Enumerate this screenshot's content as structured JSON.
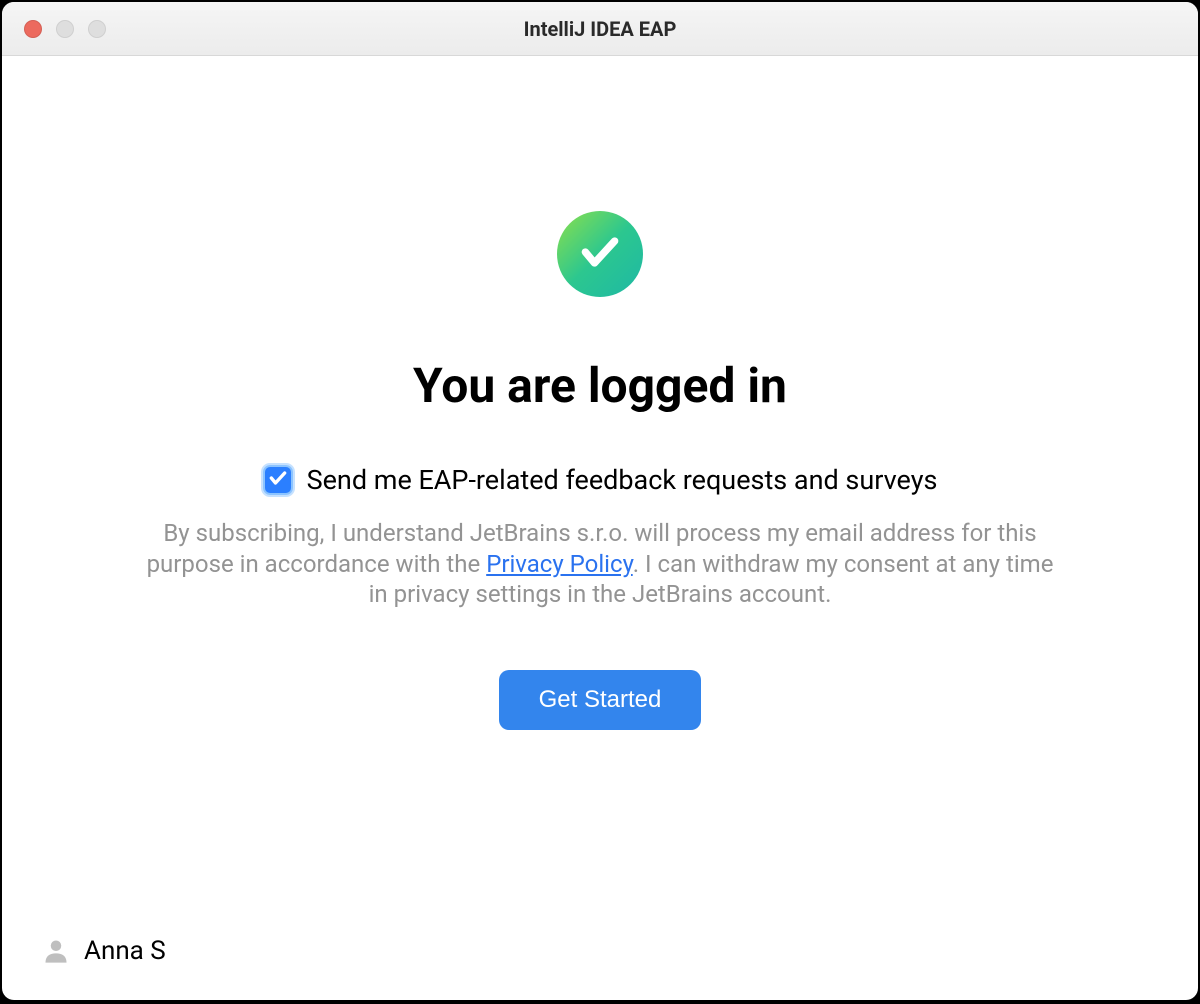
{
  "titlebar": {
    "title": "IntelliJ IDEA EAP"
  },
  "main": {
    "heading": "You are logged in",
    "checkbox_label": "Send me EAP-related feedback requests and surveys",
    "checkbox_checked": true,
    "disclaimer_part1": "By subscribing, I understand JetBrains s.r.o. will process my email address for this purpose in accordance with the ",
    "privacy_link_text": "Privacy Policy",
    "disclaimer_part2": ". I can withdraw my consent at any time in privacy settings in the JetBrains account.",
    "button_label": "Get Started"
  },
  "footer": {
    "username": "Anna S"
  }
}
